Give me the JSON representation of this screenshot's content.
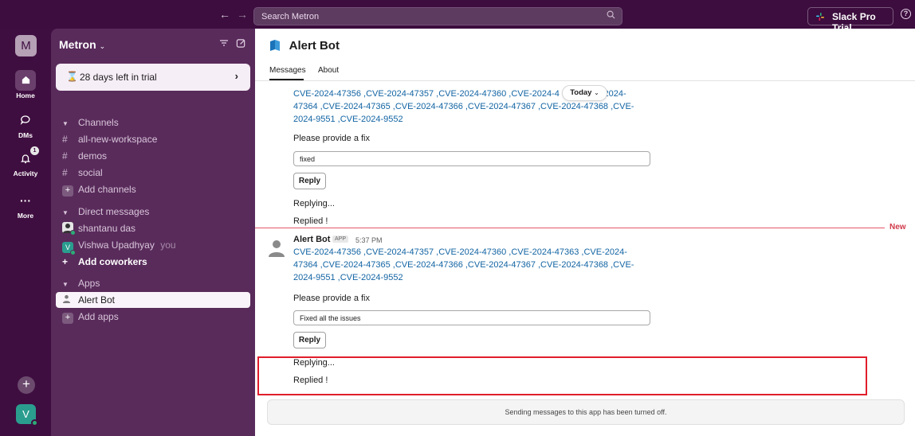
{
  "topbar": {
    "search_placeholder": "Search Metron",
    "trial_label": "Slack Pro Trial"
  },
  "rail": {
    "workspace_initial": "M",
    "home_label": "Home",
    "dms_label": "DMs",
    "activity_label": "Activity",
    "activity_badge": "1",
    "more_label": "More",
    "user_initial": "V"
  },
  "sidebar": {
    "workspace_name": "Metron",
    "trial_text": "28 days left in trial",
    "channels_header": "Channels",
    "channels": [
      "all-new-workspace",
      "demos",
      "social"
    ],
    "add_channels": "Add channels",
    "dm_header": "Direct messages",
    "dms": [
      {
        "name": "shantanu das",
        "suffix": ""
      },
      {
        "name": "Vishwa Upadhyay",
        "suffix": "you"
      }
    ],
    "add_coworkers": "Add coworkers",
    "apps_header": "Apps",
    "apps": [
      "Alert Bot"
    ],
    "add_apps": "Add apps"
  },
  "channel": {
    "title": "Alert Bot",
    "tabs": [
      "Messages",
      "About"
    ]
  },
  "messages": {
    "first": {
      "cve_lines": [
        "CVE-2024-47356 ,CVE-2024-47357 ,CVE-2024-47360 ,CVE-2024-4",
        "47364 ,CVE-2024-47365 ,CVE-2024-47366 ,CVE-2024-47367 ,CVE-2024-47368 ,CVE-",
        "2024-9551 ,CVE-2024-9552"
      ],
      "cve_line1_tail": "-2024-",
      "prompt": "Please provide a fix",
      "input_value": "fixed",
      "button": "Reply",
      "status1": "Replying...",
      "status2": "Replied !"
    },
    "today_divider": "Today",
    "new_label": "New",
    "second": {
      "author": "Alert Bot",
      "app_tag": "APP",
      "time": "5:37 PM",
      "cve_lines": [
        "CVE-2024-47356 ,CVE-2024-47357 ,CVE-2024-47360 ,CVE-2024-47363 ,CVE-2024-",
        "47364 ,CVE-2024-47365 ,CVE-2024-47366 ,CVE-2024-47367 ,CVE-2024-47368 ,CVE-",
        "2024-9551 ,CVE-2024-9552"
      ],
      "prompt": "Please provide a fix",
      "input_value": "Fixed all the issues",
      "button": "Reply",
      "status1": "Replying...",
      "status2": "Replied !"
    }
  },
  "footer_note": "Sending messages to this app has been turned off.",
  "colors": {
    "rail_bg": "#3f0e40",
    "sidebar_bg": "#592b5b",
    "link_blue": "#1264a3",
    "new_red": "#e6576a",
    "highlight_red": "#e01e2b"
  }
}
